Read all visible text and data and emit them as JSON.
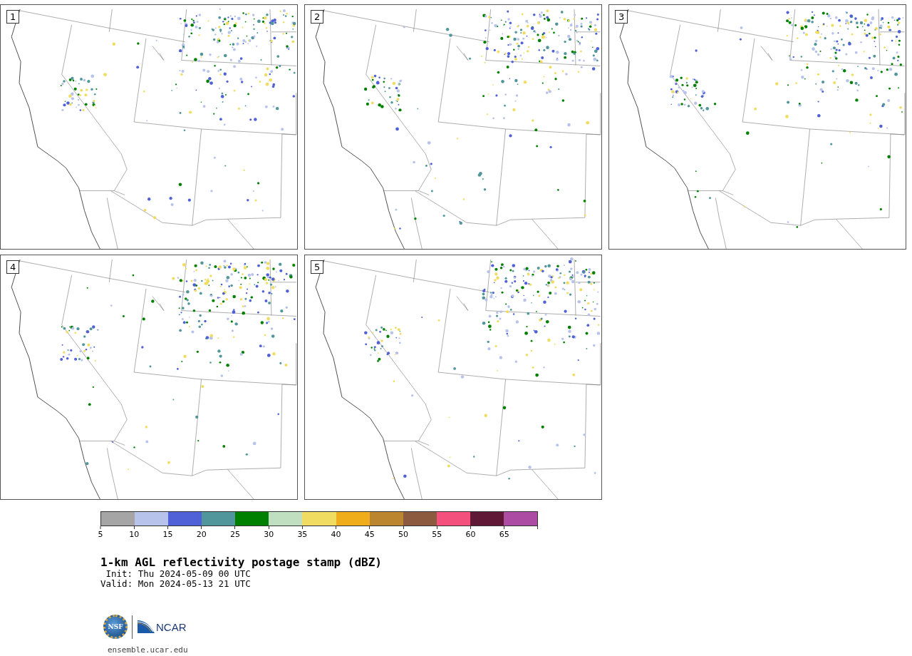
{
  "panels": [
    {
      "number": "1"
    },
    {
      "number": "2"
    },
    {
      "number": "3"
    },
    {
      "number": "4"
    },
    {
      "number": "5"
    }
  ],
  "colorbar": {
    "segments": [
      {
        "color": "#a5a5a5"
      },
      {
        "color": "#b8c3ec"
      },
      {
        "color": "#5060d6"
      },
      {
        "color": "#50969a"
      },
      {
        "color": "#008000"
      },
      {
        "color": "#c0dfc0"
      },
      {
        "color": "#f0dc60"
      },
      {
        "color": "#f0ad1a"
      },
      {
        "color": "#bb8530"
      },
      {
        "color": "#8b5a3f"
      },
      {
        "color": "#f4507d"
      },
      {
        "color": "#601837"
      },
      {
        "color": "#ad4ca3"
      }
    ],
    "ticks": [
      "5",
      "10",
      "15",
      "20",
      "25",
      "30",
      "35",
      "40",
      "45",
      "50",
      "55",
      "60",
      "65"
    ]
  },
  "title": "1-km AGL reflectivity postage stamp (dBZ)",
  "init": "Init: Thu 2024-05-09 00 UTC",
  "valid": "Valid: Mon 2024-05-13 21 UTC",
  "logo": {
    "nsf": "NSF",
    "ncar": "NCAR"
  },
  "footer": "ensemble.ucar.edu"
}
